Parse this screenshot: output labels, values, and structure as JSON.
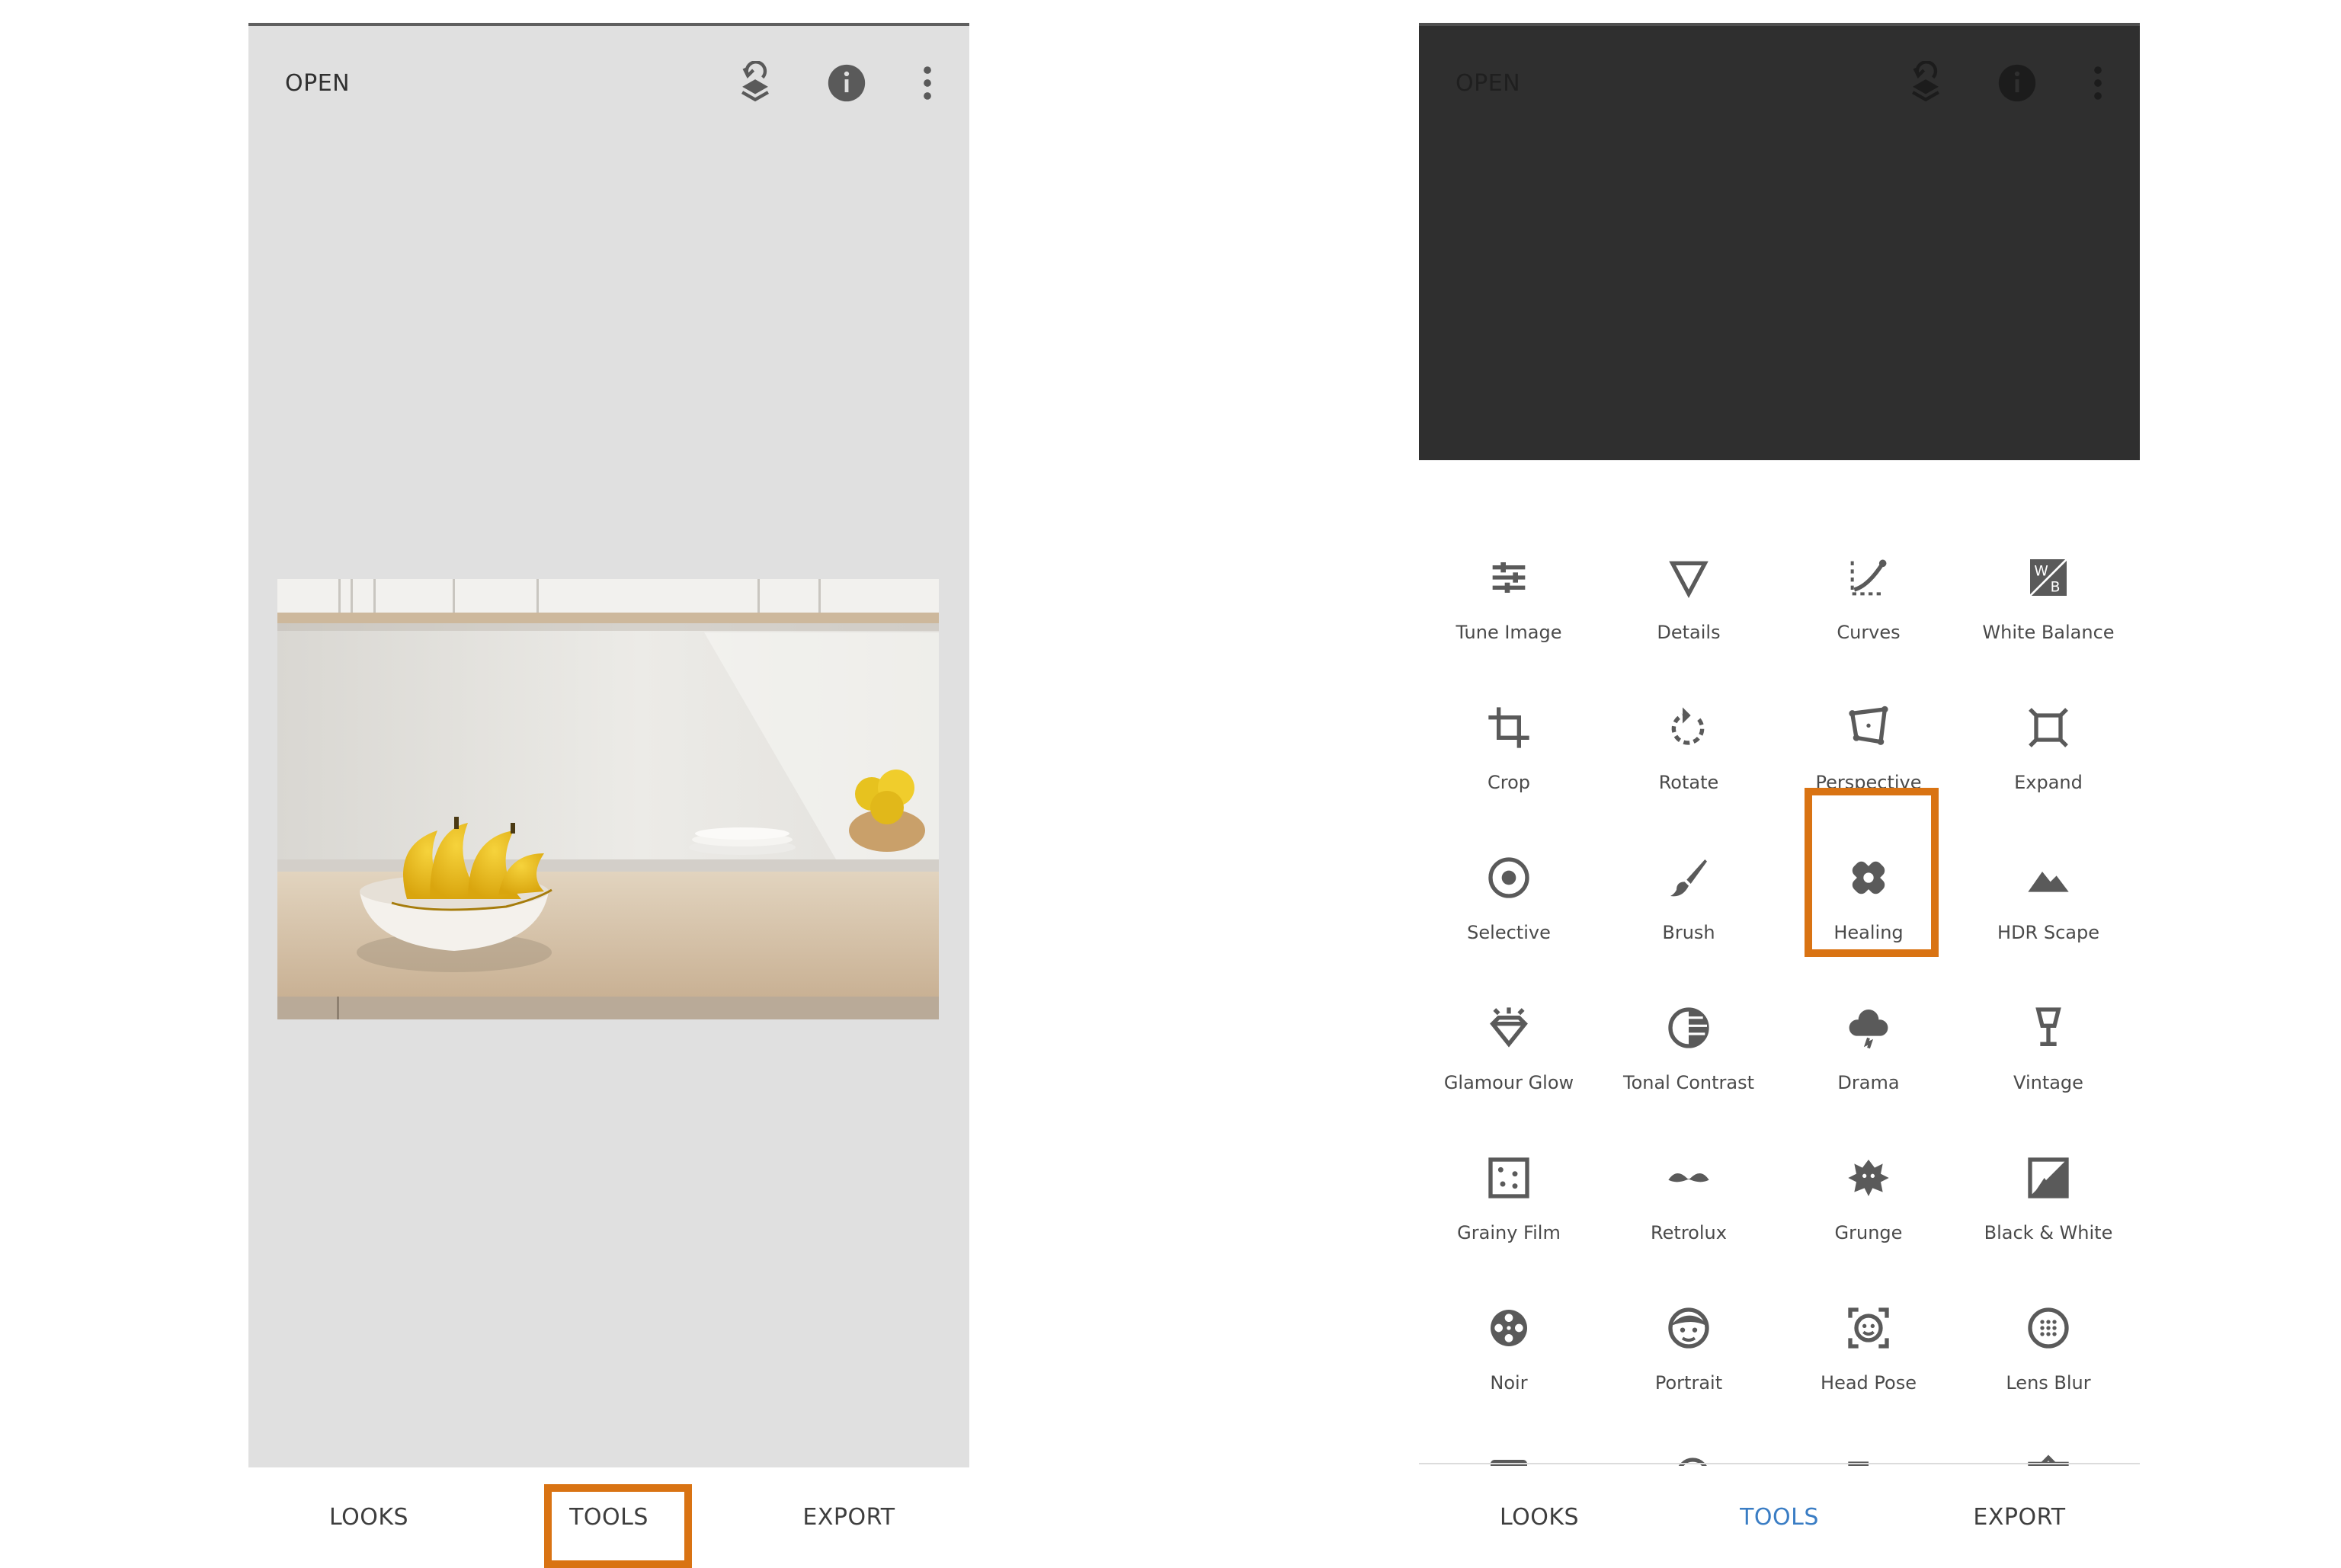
{
  "left_screen": {
    "open_label": "OPEN",
    "nav": [
      "LOOKS",
      "TOOLS",
      "EXPORT"
    ],
    "active_tab": "",
    "highlighted_tab": "TOOLS"
  },
  "right_screen": {
    "open_label": "OPEN",
    "nav": [
      "LOOKS",
      "TOOLS",
      "EXPORT"
    ],
    "active_tab": "TOOLS",
    "highlighted_tool": "Healing",
    "tools": [
      {
        "label": "Tune Image",
        "icon": "tune-image-icon"
      },
      {
        "label": "Details",
        "icon": "details-icon"
      },
      {
        "label": "Curves",
        "icon": "curves-icon"
      },
      {
        "label": "White Balance",
        "icon": "white-balance-icon"
      },
      {
        "label": "Crop",
        "icon": "crop-icon"
      },
      {
        "label": "Rotate",
        "icon": "rotate-icon"
      },
      {
        "label": "Perspective",
        "icon": "perspective-icon"
      },
      {
        "label": "Expand",
        "icon": "expand-icon"
      },
      {
        "label": "Selective",
        "icon": "selective-icon"
      },
      {
        "label": "Brush",
        "icon": "brush-icon"
      },
      {
        "label": "Healing",
        "icon": "healing-icon"
      },
      {
        "label": "HDR Scape",
        "icon": "hdr-scape-icon"
      },
      {
        "label": "Glamour Glow",
        "icon": "glamour-glow-icon"
      },
      {
        "label": "Tonal Contrast",
        "icon": "tonal-contrast-icon"
      },
      {
        "label": "Drama",
        "icon": "drama-icon"
      },
      {
        "label": "Vintage",
        "icon": "vintage-icon"
      },
      {
        "label": "Grainy Film",
        "icon": "grainy-film-icon"
      },
      {
        "label": "Retrolux",
        "icon": "retrolux-icon"
      },
      {
        "label": "Grunge",
        "icon": "grunge-icon"
      },
      {
        "label": "Black & White",
        "icon": "black-white-icon"
      },
      {
        "label": "Noir",
        "icon": "noir-icon"
      },
      {
        "label": "Portrait",
        "icon": "portrait-icon"
      },
      {
        "label": "Head Pose",
        "icon": "head-pose-icon"
      },
      {
        "label": "Lens Blur",
        "icon": "lens-blur-icon"
      },
      {
        "label": "",
        "icon": "vignette-icon"
      },
      {
        "label": "",
        "icon": "double-exposure-icon"
      },
      {
        "label": "",
        "icon": "text-icon"
      },
      {
        "label": "",
        "icon": "frames-icon"
      }
    ]
  },
  "colors": {
    "highlight": "#d97313",
    "active_tab": "#3a7dc4",
    "icon": "#5a5a5a",
    "left_background": "#e0e0e0",
    "dark_overlay": "#2f2f2f"
  }
}
